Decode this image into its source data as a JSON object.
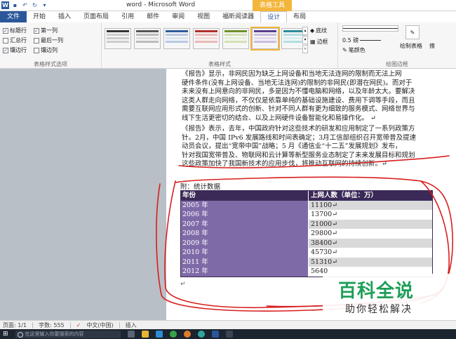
{
  "window": {
    "title": "word - Microsoft Word",
    "context_tab_title": "表格工具"
  },
  "tabs": [
    {
      "label": "文件"
    },
    {
      "label": "开始"
    },
    {
      "label": "插入"
    },
    {
      "label": "页面布局"
    },
    {
      "label": "引用"
    },
    {
      "label": "邮件"
    },
    {
      "label": "审阅"
    },
    {
      "label": "视图"
    },
    {
      "label": "福昕阅读器"
    },
    {
      "label": "设计"
    },
    {
      "label": "布局"
    }
  ],
  "ribbon": {
    "style_options": {
      "label": "表格样式选项",
      "items": [
        "标题行",
        "第一列",
        "汇总行",
        "最后一列",
        "镶边行",
        "镶边列"
      ]
    },
    "table_styles": {
      "label": "表格样式",
      "shading": "底纹",
      "borders": "边框"
    },
    "borders_group": {
      "label": "绘图边框",
      "weight": "0.5 磅",
      "pen_color": "笔颜色",
      "draw_table": "绘制表格",
      "eraser": "擦"
    }
  },
  "document": {
    "para1": [
      "《报告》显示，非网民因为缺乏上网设备和当地无法连网的限制而无法上网",
      "硬件条件(没有上网设备、当地无法连网)的限制的非网民(即潜在网民)。而对于",
      "未来没有上网意向的非网民，多是因为不懂电脑和网络，以及年龄太大。要解决",
      "这类人群走向网络，不仅仅是依靠单纯的基础设施建设、费用下调等手段，而且",
      "需要互联网应用形式的创新、针对不同人群有更为细致的服务模式、网络世界与",
      "线下生活更密切的结合、以及上网硬件设备智能化和易操作化。 ↵"
    ],
    "para2": [
      "《报告》表示，去年，中国政府针对这些技术的研发和应用制定了一系列政策方",
      "针。2月，中国 IPv6 发展路线和时间表确定；3月工信部组织召开宽带普及提速",
      "动员会议，提出“宽带中国”战略；5 月《通信业“十二五”发展规划》发布，",
      "针对我国宽带普及、物联网和云计算等新型服务业态制定了未来发展目标和规划",
      "这些政策加快了我国新技术的应用步伐，将推动互联网的持续创新。↵"
    ],
    "appendix": "附：统计数据",
    "table": {
      "headers": [
        "年份",
        "上网人数（单位：万）"
      ],
      "rows": [
        [
          "2005 年",
          "11100↵"
        ],
        [
          "2006 年",
          "13700↵"
        ],
        [
          "2007 年",
          "21000↵"
        ],
        [
          "2008 年",
          "29800↵"
        ],
        [
          "2009 年",
          "38400↵"
        ],
        [
          "2010 年",
          "45730↵"
        ],
        [
          "2011 年",
          "51310↵"
        ],
        [
          "2012 年",
          "5640"
        ]
      ]
    },
    "para_mark": "↵"
  },
  "watermark": {
    "main": "百科全说",
    "sub": "助你轻松解决"
  },
  "status_bar": {
    "page": "页面: 1/1",
    "words": "字数: 555",
    "language": "中文(中国)",
    "mode": "插入"
  },
  "taskbar": {
    "search_placeholder": "在这里输入你要搜索的内容"
  },
  "colors": {
    "accent": "#2b579a",
    "context_tab": "#f3b63c",
    "table_header": "#3b2a58",
    "table_first_col": "#7f6aa8",
    "annotation": "#d81e1e",
    "watermark": "#1e9e57"
  }
}
